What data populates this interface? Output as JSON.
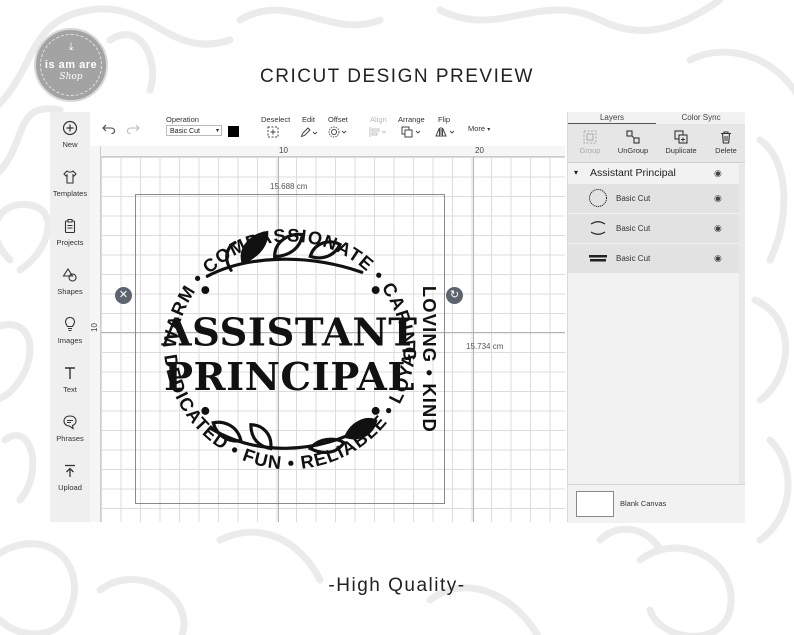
{
  "brand": {
    "name": "is am are",
    "shop": "Shop",
    "badge_color": "#a3a3a3"
  },
  "header": {
    "title": "CRICUT DESIGN PREVIEW"
  },
  "footer": {
    "tagline": "-High Quality-"
  },
  "left_sidebar": {
    "items": [
      {
        "label": "New",
        "icon": "plus-circle-icon"
      },
      {
        "label": "Templates",
        "icon": "shirt-icon"
      },
      {
        "label": "Projects",
        "icon": "clipboard-icon"
      },
      {
        "label": "Shapes",
        "icon": "shapes-icon"
      },
      {
        "label": "Images",
        "icon": "lightbulb-icon"
      },
      {
        "label": "Text",
        "icon": "text-t-icon"
      },
      {
        "label": "Phrases",
        "icon": "speech-bubble-icon"
      },
      {
        "label": "Upload",
        "icon": "upload-icon"
      }
    ]
  },
  "toolbar": {
    "operation_label": "Operation",
    "operation_value": "Basic Cut",
    "deselect_label": "Deselect",
    "edit_label": "Edit",
    "offset_label": "Offset",
    "align_label": "Align",
    "arrange_label": "Arrange",
    "flip_label": "Flip",
    "more_label": "More",
    "color_swatch": "#000000"
  },
  "canvas": {
    "ruler_top": [
      "10",
      "20"
    ],
    "ruler_left": [
      "10"
    ],
    "width_dim": "15.688 cm",
    "height_dim": "15.734 cm"
  },
  "design": {
    "title_line1": "ASSISTANT",
    "title_line2": "PRINCIPAL",
    "ring_top": "COMPASSIONATE • CARING •",
    "ring_right": "LOVING • KIND",
    "ring_bottom": "DEDICATED • FUN • RELIABLE • LOYAL •",
    "ring_left": "WARM •"
  },
  "layers_panel": {
    "tabs": [
      "Layers",
      "Color Sync"
    ],
    "actions": [
      {
        "label": "Group",
        "disabled": true
      },
      {
        "label": "UnGroup",
        "disabled": false
      },
      {
        "label": "Duplicate",
        "disabled": false
      },
      {
        "label": "Delete",
        "disabled": false
      }
    ],
    "group_name": "Assistant Principal",
    "layers": [
      {
        "label": "Basic Cut"
      },
      {
        "label": "Basic Cut"
      },
      {
        "label": "Basic Cut"
      }
    ],
    "blank_canvas_label": "Blank Canvas"
  }
}
